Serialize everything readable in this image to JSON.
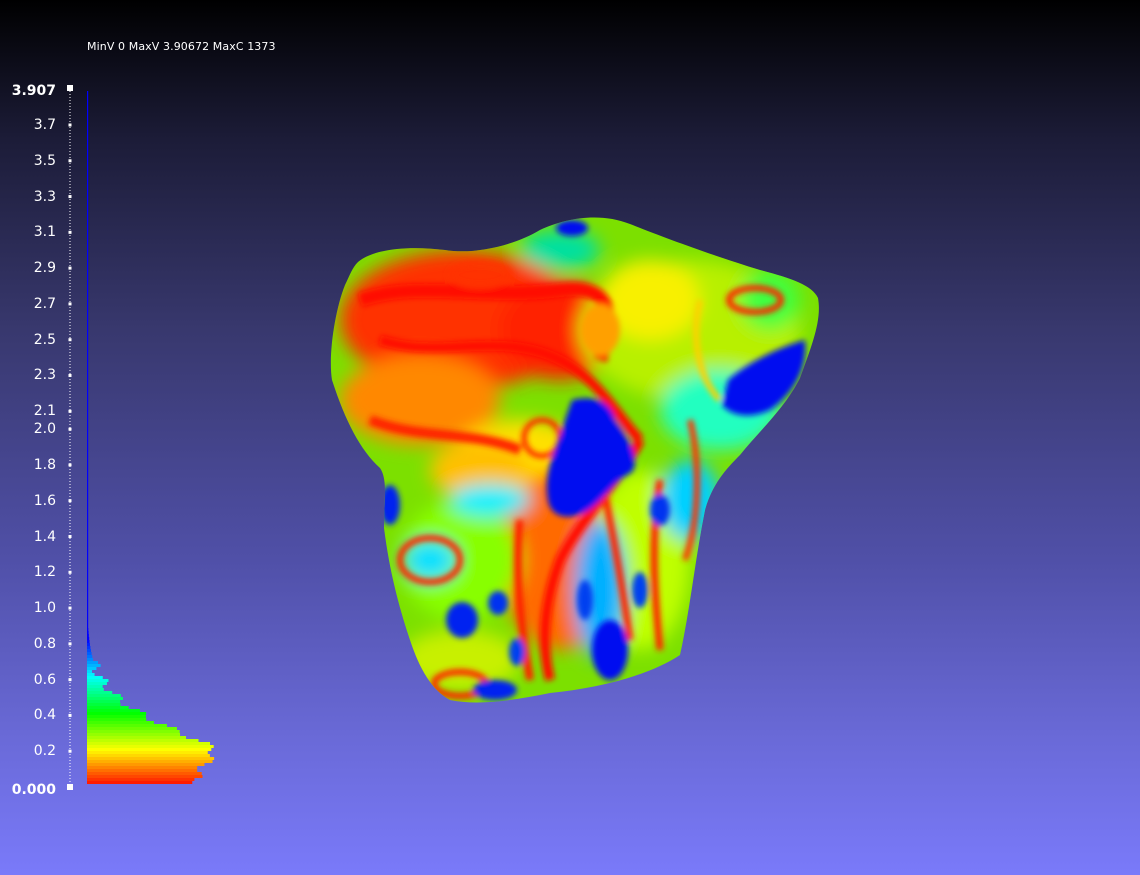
{
  "viewport": {
    "info_text": "MinV 0 MaxV 3.90672 MaxC 1373"
  },
  "colorbar": {
    "min_label": "0.000",
    "max_label": "3.907",
    "ticks": [
      "0.2",
      "0.4",
      "0.6",
      "0.8",
      "1.0",
      "1.2",
      "1.4",
      "1.6",
      "1.8",
      "2.0",
      "2.1",
      "2.3",
      "2.5",
      "2.7",
      "2.9",
      "3.1",
      "3.3",
      "3.5",
      "3.7"
    ],
    "colormap": [
      "#ff0000",
      "#ffff00",
      "#00ff00",
      "#00ffff",
      "#0000ff"
    ]
  },
  "histogram": {
    "min_value": 0,
    "max_value": 3.90672,
    "max_count": 1373
  },
  "mesh": {
    "name": "scalar-colored mesh"
  }
}
